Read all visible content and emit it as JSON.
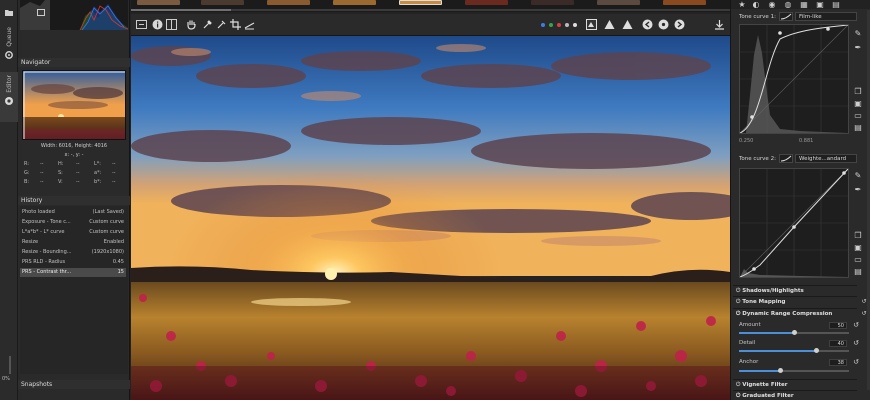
{
  "vtabs": {
    "queue": "Queue",
    "editor": "Editor",
    "zoom_percent": "0%"
  },
  "navigator": {
    "title": "Navigator",
    "dims": "Width: 6016, Height: 4016",
    "coords": "x: -, y: -",
    "values": {
      "R": "R:",
      "R_v": "--",
      "H": "H:",
      "H_v": "--",
      "L": "L*:",
      "L_v": "--",
      "G": "G:",
      "G_v": "--",
      "S": "S:",
      "S_v": "--",
      "a": "a*:",
      "a_v": "--",
      "B": "B:",
      "B_v": "--",
      "V": "V:",
      "V_v": "--",
      "b": "b*:",
      "b_v": "--"
    }
  },
  "history": {
    "title": "History",
    "rows": [
      {
        "name": "Photo loaded",
        "value": "(Last Saved)"
      },
      {
        "name": "Exposure - Tone c...",
        "value": "Custom curve"
      },
      {
        "name": "L*a*b* - L* curve",
        "value": "Custom curve"
      },
      {
        "name": "Resize",
        "value": "Enabled"
      },
      {
        "name": "Resize - Bounding...",
        "value": "(1920x1080)"
      },
      {
        "name": "PRS RLD - Radius",
        "value": "0.45"
      },
      {
        "name": "PRS - Contrast thr...",
        "value": "15"
      }
    ]
  },
  "snapshots": {
    "title": "Snapshots"
  },
  "toolbar": {
    "icons": [
      "hand-icon",
      "color-picker-icon",
      "crop-icon",
      "straighten-icon"
    ]
  },
  "curves": {
    "tc1_label": "Tone curve 1:",
    "tc1_mode": "Film-like",
    "tc1_readout_l": "0.250",
    "tc1_readout_r": "0.881",
    "tc2_label": "Tone curve 2:",
    "tc2_mode": "Weighte...andard"
  },
  "tools": {
    "shadows_highlights": "Shadows/Highlights",
    "tone_mapping": "Tone Mapping",
    "drc": "Dynamic Range Compression",
    "amount_label": "Amount",
    "amount_value": "50",
    "amount_frac": 0.5,
    "detail_label": "Detail",
    "detail_value": "40",
    "detail_frac": 0.7,
    "anchor_label": "Anchor",
    "anchor_value": "38",
    "anchor_frac": 0.38,
    "vignette": "Vignette Filter",
    "graduated": "Graduated Filter"
  },
  "colors": {
    "accent": "#4b8fd8",
    "panel": "#2a2a2a",
    "bg": "#232323"
  }
}
